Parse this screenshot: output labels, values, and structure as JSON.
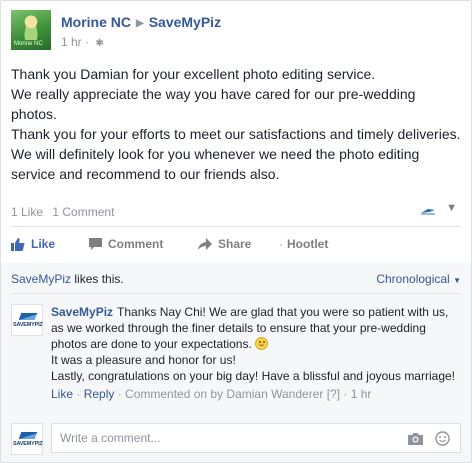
{
  "header": {
    "author": "Morine NC",
    "page": "SaveMyPiz",
    "time": "1 hr",
    "avatar_text": "Morine NC"
  },
  "post": {
    "lines": [
      "Thank you Damian for your excellent photo editing service.",
      "We really appreciate the way you have cared for our pre-wedding photos.",
      "Thank you for your efforts to meet our satisfactions and timely deliveries.",
      "We will definitely look for you whenever we need the photo editing service and recommend to our friends also."
    ]
  },
  "counts": {
    "likes": "1 Like",
    "comments": "1 Comment"
  },
  "actions": {
    "like": "Like",
    "comment": "Comment",
    "share": "Share",
    "hootlet": "Hootlet"
  },
  "comments_area": {
    "liker": "SaveMyPiz",
    "likes_suffix": " likes this.",
    "sort": "Chronological",
    "comment": {
      "author": "SaveMyPiz",
      "text1": "Thanks Nay Chi! We are glad that you were so patient with us, as we worked through the finer details to ensure that your pre-wedding photos are done to your expectations.",
      "text2": "It was a pleasure and honor for us!",
      "text3": "Lastly, congratulations on your big day! Have a blissful and joyous marriage!",
      "like": "Like",
      "reply": "Reply",
      "commented_by": "Commented on by Damian Wanderer",
      "info": "[?]",
      "time": "1 hr"
    },
    "logo_label": "SAVEMYPIZ",
    "write_placeholder": "Write a comment..."
  },
  "colors": {
    "link": "#365899",
    "like_active": "#4267b2",
    "muted": "#90949c"
  }
}
